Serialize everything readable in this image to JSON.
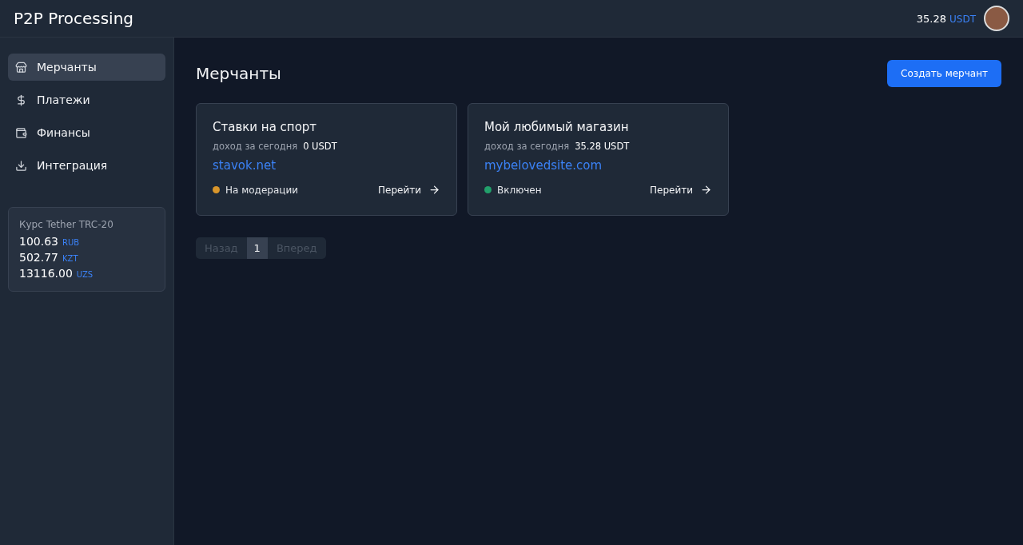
{
  "header": {
    "logo": "P2P Processing",
    "balance": "35.28",
    "currency": "USDT"
  },
  "sidebar": {
    "items": [
      {
        "label": "Мерчанты",
        "selected": true
      },
      {
        "label": "Платежи",
        "selected": false
      },
      {
        "label": "Финансы",
        "selected": false
      },
      {
        "label": "Интеграция",
        "selected": false
      }
    ],
    "rates": {
      "title": "Курс Tether TRC-20",
      "rows": [
        {
          "value": "100.63",
          "currency": "RUB"
        },
        {
          "value": "502.77",
          "currency": "KZT"
        },
        {
          "value": "13116.00",
          "currency": "UZS"
        }
      ]
    }
  },
  "page": {
    "title": "Мерчанты",
    "create_button": "Создать мерчант"
  },
  "merchants": [
    {
      "name": "Ставки на спорт",
      "income_label": "доход за сегодня",
      "income": "0 USDT",
      "site": "stavok.net",
      "status": "На модерации",
      "color": "#d9962b",
      "link": "Перейти"
    },
    {
      "name": "Мой любимый магазин",
      "income_label": "доход за сегодня",
      "income": "35.28 USDT",
      "site": "mybelovedsite.com",
      "status": "Включен",
      "color": "#22a06b",
      "link": "Перейти"
    }
  ],
  "pagination": {
    "prev": {
      "label": "Назад",
      "disabled": true
    },
    "pages": [
      {
        "label": "1",
        "selected": true
      }
    ],
    "next": {
      "label": "Вперед",
      "disabled": true
    }
  }
}
